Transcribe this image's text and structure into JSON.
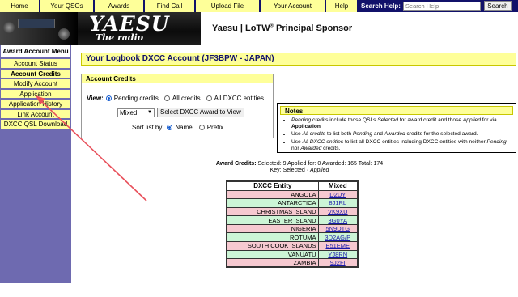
{
  "topnav": {
    "items": [
      "Home",
      "Your QSOs",
      "Awards",
      "Find Call",
      "Upload File",
      "Your Account",
      "Help"
    ],
    "search_label": "Search Help:",
    "search_placeholder": "Search Help",
    "search_button": "Search"
  },
  "banner": {
    "logo_text": "YAESU",
    "logo_sub": "The radio",
    "sponsor_prefix": "Yaesu | LoTW",
    "sponsor_reg": "®",
    "sponsor_suffix": " Principal Sponsor"
  },
  "sidebar": {
    "title": "Award Account Menu",
    "items": [
      "Account Status",
      "Account Credits",
      "Modify Account",
      "Application",
      "Application History",
      "Link Account",
      "DXCC QSL Download"
    ],
    "active": "Account Credits"
  },
  "main": {
    "title": "Your Logbook DXCC Account (JF3BPW - JAPAN)"
  },
  "credits": {
    "head": "Account Credits",
    "view_label": "View:",
    "view_options": [
      "Pending credits",
      "All credits",
      "All DXCC entities"
    ],
    "selected_view": "Pending credits",
    "award_select": "Mixed",
    "select_button": "Select DXCC Award to View",
    "sort_label": "Sort list by",
    "sort_options": [
      "Name",
      "Prefix"
    ],
    "selected_sort": "Name"
  },
  "notes": {
    "head": "Notes",
    "items": [
      [
        "",
        "Pending",
        " credits include those QSLs ",
        "Selected",
        " for award credit and those ",
        "Applied",
        " for via ",
        "Application",
        ""
      ],
      [
        "Use ",
        "All credits",
        " to list both ",
        "Pending",
        " and ",
        "Awarded",
        " credits for the selected award.",
        "",
        ""
      ],
      [
        "Use ",
        "All DXCC entities",
        " to list all DXCC entities including DXCC entities with neither ",
        "Pending",
        " nor ",
        "Awarded",
        " credits.",
        "",
        ""
      ]
    ]
  },
  "award_summary": {
    "label": "Award Credits:",
    "line1": "Selected: 9 Applied for: 0 Awarded: 165 Total: 174",
    "key_label": "Key:",
    "key_selected": "Selected",
    "key_sep": " · ",
    "key_applied": "Applied"
  },
  "table": {
    "headers": [
      "DXCC Entity",
      "Mixed"
    ],
    "rows": [
      {
        "entity": "ANGOLA",
        "call": "D2UY",
        "color": "#f6c9d0"
      },
      {
        "entity": "ANTARCTICA",
        "call": "8J1RL",
        "color": "#ccf5d6"
      },
      {
        "entity": "CHRISTMAS ISLAND",
        "call": "VK9XU",
        "color": "#f6c9d0"
      },
      {
        "entity": "EASTER ISLAND",
        "call": "3G0YA",
        "color": "#ccf5d6"
      },
      {
        "entity": "NIGERIA",
        "call": "5N9DTG",
        "color": "#f6c9d0"
      },
      {
        "entity": "ROTUMA",
        "call": "3D2AG/P",
        "color": "#ccf5d6"
      },
      {
        "entity": "SOUTH COOK ISLANDS",
        "call": "E51EME",
        "color": "#f6c9d0"
      },
      {
        "entity": "VANUATU",
        "call": "YJ8RN",
        "color": "#ccf5d6"
      },
      {
        "entity": "ZAMBIA",
        "call": "9J2FI",
        "color": "#f6c9d0"
      }
    ]
  },
  "colors": {
    "nav_bg": "#11116a",
    "nav_item": "#feff99",
    "sidebar_bg": "#6e6ab0",
    "arrow": "#e8505b"
  }
}
